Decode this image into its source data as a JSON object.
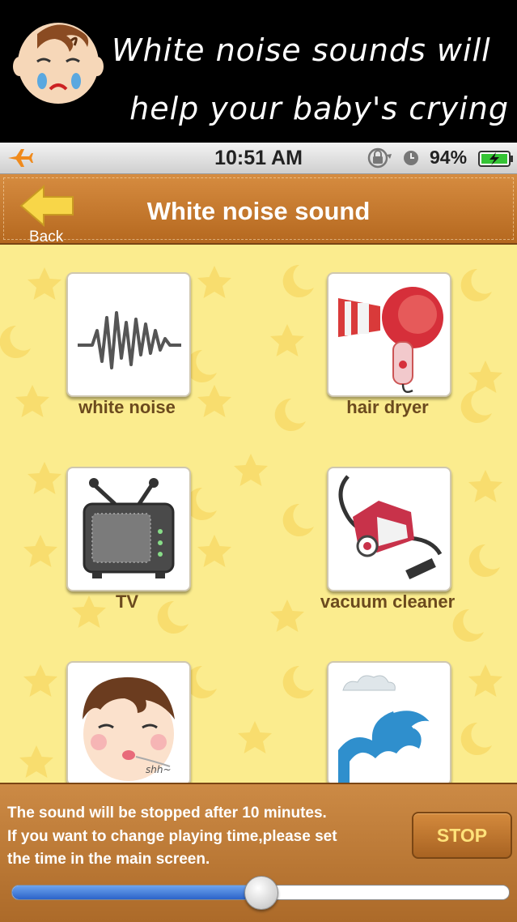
{
  "promo": {
    "line1": "White noise sounds will",
    "line2": "help your baby's crying"
  },
  "status_bar": {
    "time": "10:51 AM",
    "battery": "94%",
    "icons": [
      "airplane-icon",
      "rotation-lock-icon",
      "alarm-clock-icon",
      "battery-charging-icon"
    ]
  },
  "nav": {
    "back_label": "Back",
    "title": "White noise sound"
  },
  "sounds": [
    {
      "label": "white noise",
      "icon": "waveform-icon"
    },
    {
      "label": "hair dryer",
      "icon": "hair-dryer-icon"
    },
    {
      "label": "TV",
      "icon": "tv-icon"
    },
    {
      "label": "vacuum cleaner",
      "icon": "vacuum-cleaner-icon"
    },
    {
      "label": "",
      "icon": "shushing-face-icon",
      "badge": "shh~"
    },
    {
      "label": "",
      "icon": "ocean-wave-icon"
    }
  ],
  "footer": {
    "message_line1": "The sound will be stopped after 10 minutes.",
    "message_line2": "If you want to change playing time,please set",
    "message_line3": "the time in the main screen.",
    "stop_label": "STOP",
    "slider_fraction": 0.5
  },
  "colors": {
    "nav_brown": "#c57a30",
    "content_yellow": "#fbec8e",
    "label_brown": "#6b4a1e",
    "stop_text": "#ffe27a",
    "slider_blue": "#2b63c9"
  }
}
